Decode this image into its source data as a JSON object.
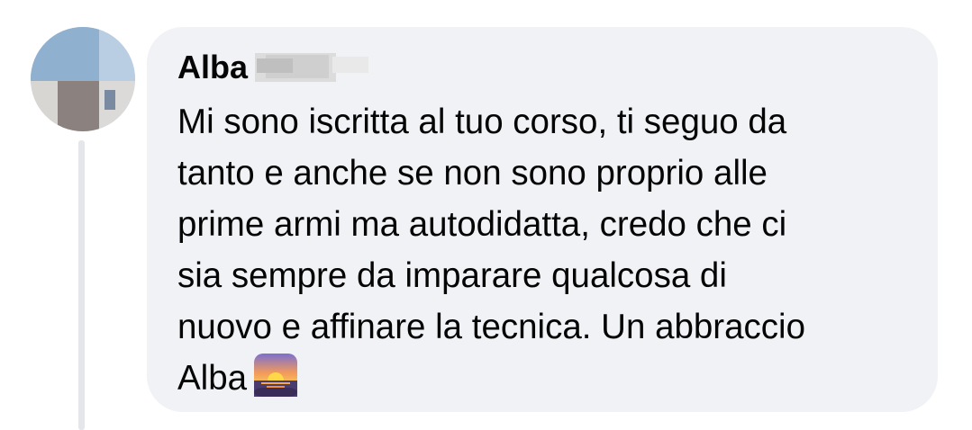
{
  "comment": {
    "author": "Alba",
    "text_lines": [
      "Mi sono iscritta al tuo corso, ti seguo da",
      "tanto e anche se non sono proprio alle",
      "prime armi ma autodidatta, credo che ci",
      "sia sempre da imparare qualcosa di",
      "nuovo e affinare la tecnica. Un abbraccio",
      "Alba"
    ],
    "emoji": "sunset-emoji-icon"
  },
  "colors": {
    "bubble": "#f0f2f5",
    "thread_line": "#e4e6eb",
    "text": "#050505"
  }
}
